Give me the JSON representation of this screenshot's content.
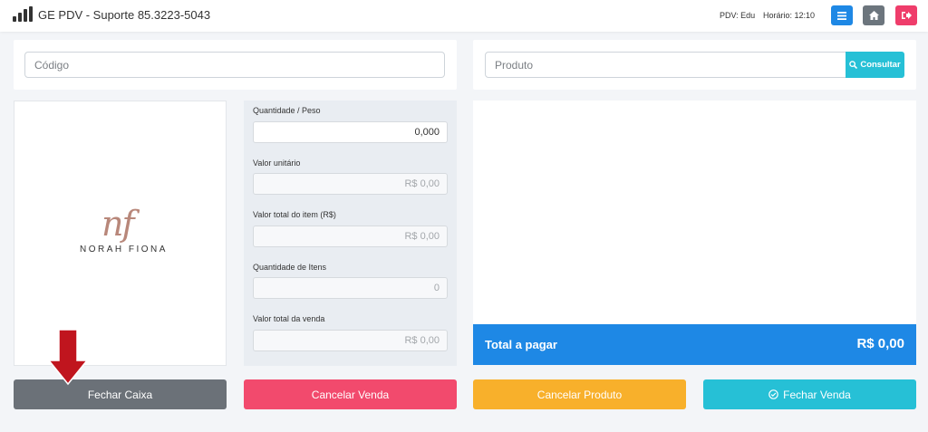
{
  "header": {
    "title": "GE PDV - Suporte 85.3223-5043",
    "pdv_label": "PDV: Edu",
    "time_label": "Horário: 12:10",
    "buttons": {
      "menu_icon": "menu-icon",
      "home_icon": "home-icon",
      "logout_icon": "logout-icon"
    }
  },
  "search": {
    "code_placeholder": "Código",
    "product_placeholder": "Produto",
    "consult_label": "Consultar"
  },
  "logo": {
    "monogram": "nf",
    "name": "NORAH FIONA"
  },
  "form": {
    "fields": [
      {
        "label": "Quantidade / Peso",
        "value": "0,000"
      },
      {
        "label": "Valor unitário",
        "value": "R$ 0,00"
      },
      {
        "label": "Valor total do item (R$)",
        "value": "R$ 0,00"
      },
      {
        "label": "Quantidade de Itens",
        "value": "0"
      },
      {
        "label": "Valor total da venda",
        "value": "R$ 0,00"
      }
    ]
  },
  "total": {
    "label": "Total a pagar",
    "value": "R$ 0,00"
  },
  "actions": {
    "close_register": "Fechar Caixa",
    "cancel_sale": "Cancelar Venda",
    "cancel_product": "Cancelar Produto",
    "close_sale": "Fechar Venda"
  },
  "colors": {
    "primary": "#1e88e5",
    "danger": "#f24a6d",
    "warning": "#f8b02b",
    "info": "#26c0d6",
    "secondary": "#6b7178",
    "arrow": "#c0151e"
  }
}
